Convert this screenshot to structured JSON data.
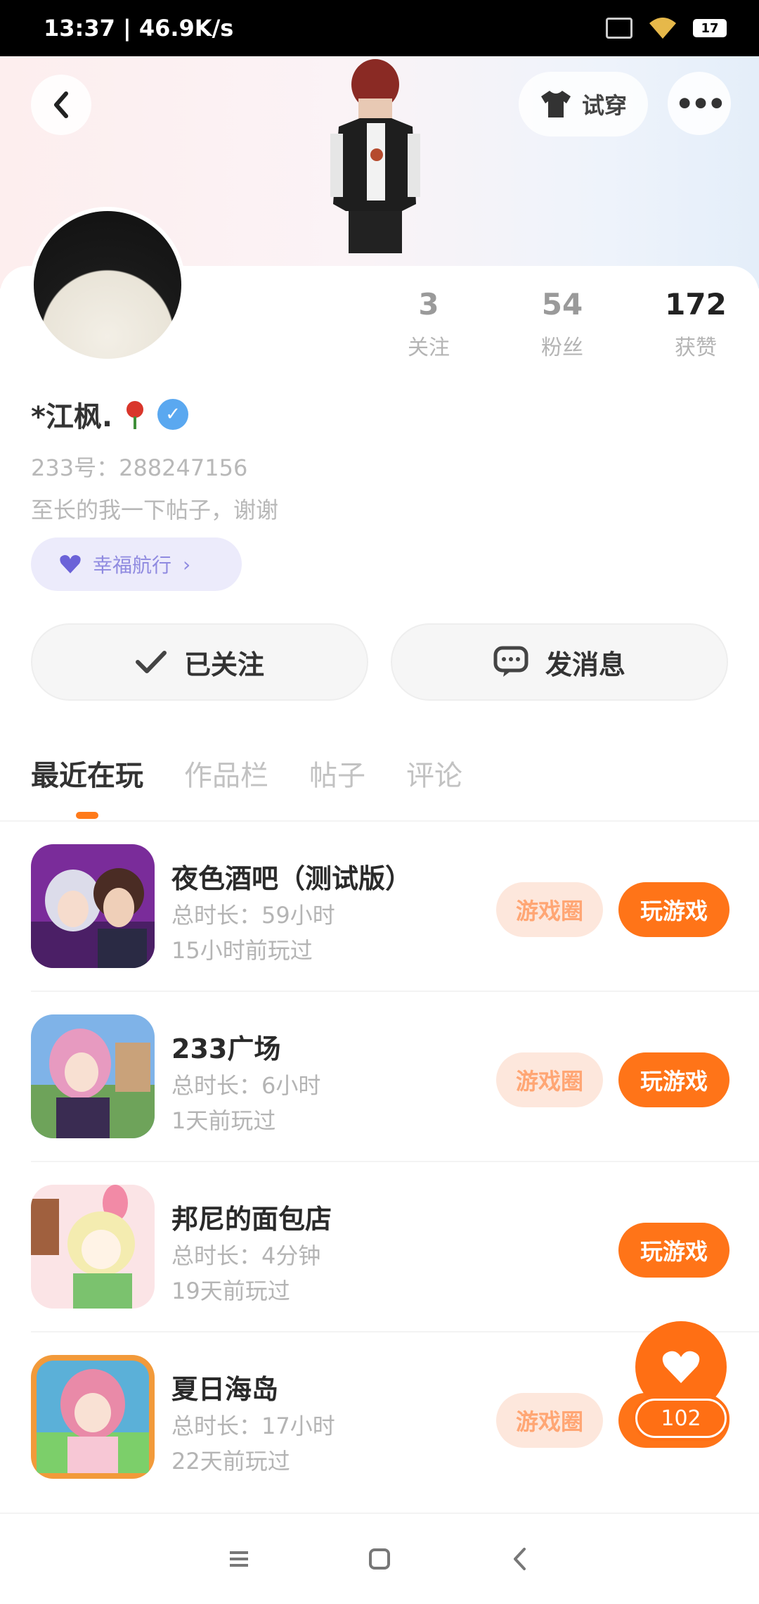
{
  "status_bar": {
    "time_speed": "13:37 | 46.9K/s",
    "battery": "17"
  },
  "header": {
    "tryon_label": "试穿"
  },
  "profile": {
    "username": "*江枫.",
    "user_id": "233号：288247156",
    "signature": "至长的我一下帖子，谢谢",
    "tag_label": "幸福航行",
    "stats": [
      {
        "value": "3",
        "label": "关注"
      },
      {
        "value": "54",
        "label": "粉丝"
      },
      {
        "value": "172",
        "label": "获赞"
      }
    ]
  },
  "actions": {
    "follow_label": "已关注",
    "message_label": "发消息"
  },
  "tabs": [
    "最近在玩",
    "作品栏",
    "帖子",
    "评论"
  ],
  "games": [
    {
      "name": "夜色酒吧（测试版）",
      "duration": "总时长：59小时",
      "last_played": "15小时前玩过",
      "circle_label": "游戏圈",
      "play_label": "玩游戏",
      "has_circle": true
    },
    {
      "name": "233广场",
      "duration": "总时长：6小时",
      "last_played": "1天前玩过",
      "circle_label": "游戏圈",
      "play_label": "玩游戏",
      "has_circle": true
    },
    {
      "name": "邦尼的面包店",
      "duration": "总时长：4分钟",
      "last_played": "19天前玩过",
      "circle_label": "",
      "play_label": "玩游戏",
      "has_circle": false
    },
    {
      "name": "夏日海岛",
      "duration": "总时长：17小时",
      "last_played": "22天前玩过",
      "circle_label": "游戏圈",
      "play_label": "玩游戏",
      "has_circle": true
    }
  ],
  "like": {
    "count": "102"
  },
  "colors": {
    "accent": "#ff7418",
    "circle_bg": "#fde7dc",
    "circle_text": "#ffa674"
  }
}
